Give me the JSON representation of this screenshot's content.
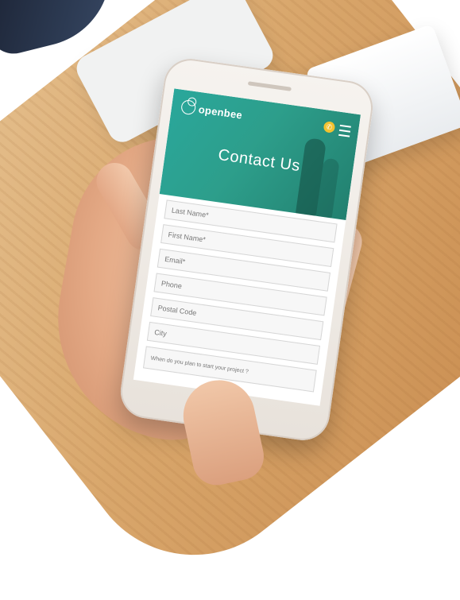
{
  "screen": {
    "brand": {
      "name": "openbee",
      "tagline": ""
    },
    "header": {
      "title": "Contact Us"
    },
    "icons": {
      "phone": "phone-icon",
      "menu": "hamburger-menu-icon"
    },
    "colors": {
      "hero": "#2aa79b",
      "accent": "#f2c230"
    },
    "form": {
      "fields": [
        {
          "placeholder": "Last Name*"
        },
        {
          "placeholder": "First Name*"
        },
        {
          "placeholder": "Email*"
        },
        {
          "placeholder": "Phone"
        },
        {
          "placeholder": "Postal Code"
        },
        {
          "placeholder": "City"
        },
        {
          "placeholder": "When do you plan to start your project ?"
        }
      ]
    }
  }
}
